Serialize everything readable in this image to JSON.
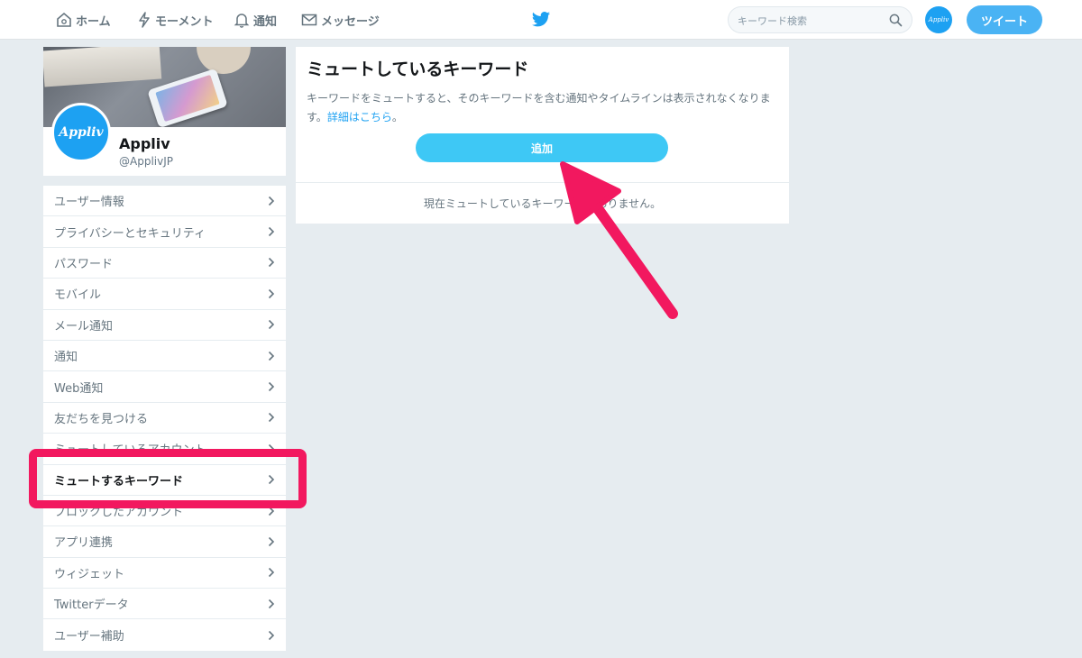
{
  "nav": {
    "home": "ホーム",
    "moments": "モーメント",
    "notifications": "通知",
    "messages": "メッセージ",
    "search_placeholder": "キーワード検索",
    "avatar_text": "Appliv",
    "tweet": "ツイート"
  },
  "profile": {
    "avatar_text": "Appliv",
    "name": "Appliv",
    "handle": "@ApplivJP"
  },
  "menu": {
    "items": [
      {
        "label": "ユーザー情報"
      },
      {
        "label": "プライバシーとセキュリティ"
      },
      {
        "label": "パスワード"
      },
      {
        "label": "モバイル"
      },
      {
        "label": "メール通知"
      },
      {
        "label": "通知"
      },
      {
        "label": "Web通知"
      },
      {
        "label": "友だちを見つける"
      },
      {
        "label": "ミュートしているアカウント"
      },
      {
        "label": "ミュートするキーワード"
      },
      {
        "label": "ブロックしたアカウント"
      },
      {
        "label": "アプリ連携"
      },
      {
        "label": "ウィジェット"
      },
      {
        "label": "Twitterデータ"
      },
      {
        "label": "ユーザー補助"
      }
    ]
  },
  "main": {
    "title": "ミュートしているキーワード",
    "description": "キーワードをミュートすると、そのキーワードを含む通知やタイムラインは表示されなくなります。",
    "details_link": "詳細はこちら",
    "period": "。",
    "add_button": "追加",
    "empty_message": "現在ミュートしているキーワードはありません。"
  },
  "colors": {
    "accent": "#1da1f2",
    "button": "#3ec8f5",
    "highlight": "#f2185f"
  }
}
